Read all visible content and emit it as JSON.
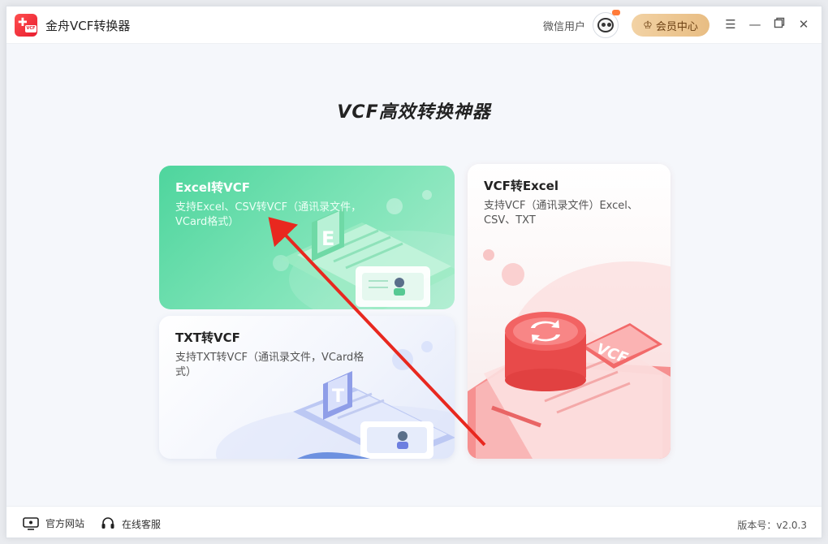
{
  "titlebar": {
    "app_title": "金舟VCF转换器",
    "logo_tag": "VCF",
    "user_name": "微信用户",
    "vip_label": "会员中心"
  },
  "heading": "VCF高效转换神器",
  "cards": [
    {
      "title": "Excel转VCF",
      "desc": "支持Excel、CSV转VCF（通讯录文件，VCard格式）",
      "deco": "E"
    },
    {
      "title": "TXT转VCF",
      "desc": "支持TXT转VCF（通讯录文件，VCard格式）",
      "deco": "T"
    },
    {
      "title": "VCF转Excel",
      "desc": "支持VCF（通讯录文件）Excel、CSV、TXT",
      "deco": "VCF"
    }
  ],
  "footer": {
    "website_label": "官方网站",
    "support_label": "在线客服",
    "version_label": "版本号：",
    "version_value": "v2.0.3"
  },
  "colors": {
    "excel_card": "#4ed59d",
    "vcf_accent": "#f2525a",
    "txt_accent": "#6d7fe0",
    "vip_gold": "#e8bd83",
    "annotation_arrow": "#e8281f"
  },
  "icons": [
    "app-logo",
    "crown-icon",
    "menu-icon",
    "minimize-icon",
    "restore-icon",
    "close-icon",
    "monitor-icon",
    "headset-icon"
  ]
}
